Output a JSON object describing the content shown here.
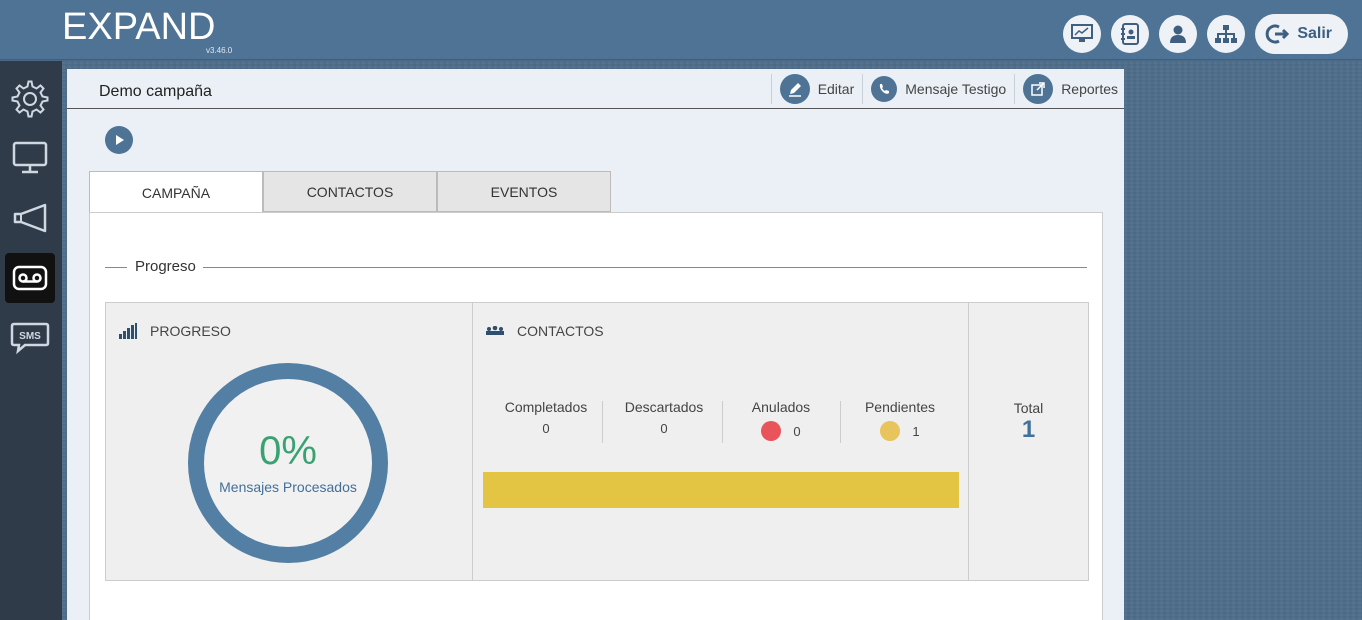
{
  "app": {
    "logo": "EXPAND",
    "version": "v3.46.0"
  },
  "topbar": {
    "icons": [
      "monitor-chart-icon",
      "contacts-book-icon",
      "user-icon",
      "network-icon"
    ],
    "logout_label": "Salir"
  },
  "sidebar": {
    "items": [
      {
        "icon": "gear-icon"
      },
      {
        "icon": "monitor-icon"
      },
      {
        "icon": "megaphone-icon"
      },
      {
        "icon": "voicemail-icon",
        "active": true
      },
      {
        "icon": "sms-icon",
        "text": "SMS"
      }
    ]
  },
  "panel": {
    "title": "Demo campaña",
    "actions": {
      "edit": "Editar",
      "witness": "Mensaje Testigo",
      "reports": "Reportes"
    }
  },
  "tabs": [
    "CAMPAÑA",
    "CONTACTOS",
    "EVENTOS"
  ],
  "section": {
    "legend": "Progreso"
  },
  "progress": {
    "heading": "PROGRESO",
    "percent": "0%",
    "caption": "Mensajes Procesados"
  },
  "contacts": {
    "heading": "CONTACTOS",
    "stats": [
      {
        "label": "Completados",
        "value": "0"
      },
      {
        "label": "Descartados",
        "value": "0"
      },
      {
        "label": "Anulados",
        "value": "0",
        "color": "#e9545a"
      },
      {
        "label": "Pendientes",
        "value": "1",
        "color": "#e8c45c"
      }
    ],
    "bar_color": "#e3c443",
    "pending_fraction": 1.0
  },
  "total": {
    "label": "Total",
    "value": "1"
  }
}
